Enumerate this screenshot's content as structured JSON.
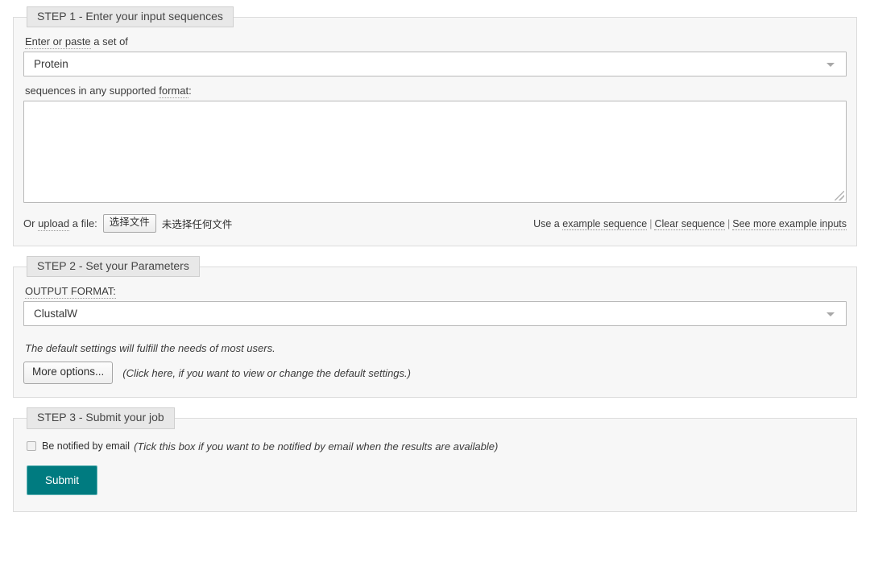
{
  "step1": {
    "legend": "STEP 1 - Enter your input sequences",
    "label_prefix": "Enter or paste",
    "label_suffix": " a set of",
    "sequence_type": "Protein",
    "format_label_prefix": "sequences in any supported ",
    "format_label_link": "format",
    "format_label_suffix": ":",
    "textarea_value": "",
    "textarea_placeholder": "",
    "upload_prefix": "Or ",
    "upload_link": "upload",
    "upload_suffix": " a file:",
    "file_button": "选择文件",
    "file_status": "未选择任何文件",
    "links_prefix": "Use a ",
    "link_example": "example sequence",
    "link_clear": "Clear sequence",
    "link_more": "See more example inputs",
    "separator": "|"
  },
  "step2": {
    "legend": "STEP 2 - Set your Parameters",
    "output_format_label": "OUTPUT FORMAT:",
    "output_format_value": "ClustalW",
    "default_note": "The default settings will fulfill the needs of most users.",
    "more_options_button": "More options...",
    "more_options_note": "(Click here, if you want to view or change the default settings.)"
  },
  "step3": {
    "legend": "STEP 3 - Submit your job",
    "email_label": "Be notified by email",
    "email_note": "(Tick this box if you want to be notified by email when the results are available)",
    "email_checked": false,
    "submit_label": "Submit"
  },
  "colors": {
    "submit_background": "#007b80",
    "legend_background": "#e8e8e8",
    "fieldset_background": "#f7f7f7",
    "border": "#dcdcdc"
  }
}
